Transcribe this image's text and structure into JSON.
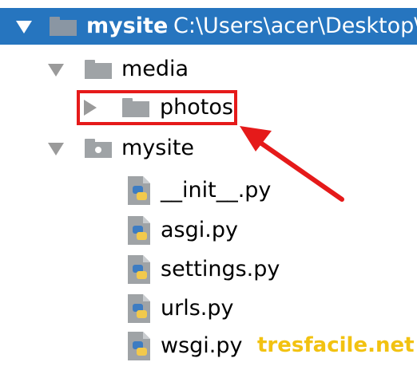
{
  "tree": {
    "root": {
      "name": "mysite",
      "path": "C:\\Users\\acer\\Desktop\\"
    },
    "media": {
      "name": "media",
      "children": {
        "photos": {
          "name": "photos"
        }
      }
    },
    "package": {
      "name": "mysite",
      "files": [
        {
          "name": "__init__.py"
        },
        {
          "name": "asgi.py"
        },
        {
          "name": "settings.py"
        },
        {
          "name": "urls.py"
        },
        {
          "name": "wsgi.py"
        }
      ]
    }
  },
  "watermark": "tresfacile.net",
  "colors": {
    "selection": "#2675bf",
    "annotation_red": "#e51a1a",
    "watermark_gold": "#f2c211",
    "folder_gray": "#9fa3a6",
    "expander_gray": "#9a9a9a"
  },
  "icons": {
    "expanded": "triangle-down-icon",
    "collapsed": "triangle-right-icon",
    "folder": "folder-icon",
    "package": "package-folder-icon",
    "python": "python-file-icon"
  }
}
